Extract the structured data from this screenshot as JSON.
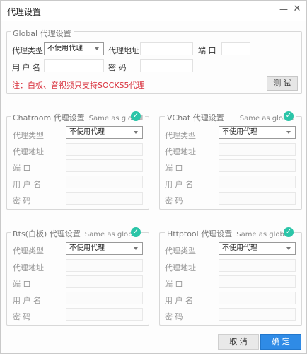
{
  "window": {
    "title": "代理设置",
    "minimize": "—",
    "close": "✕"
  },
  "global": {
    "legend": "Global 代理设置",
    "type_label": "代理类型",
    "type_value": "不使用代理",
    "address_label": "代理地址",
    "port_label": "端  口",
    "username_label": "用 户 名",
    "password_label": "密  码",
    "note": "注：白板、音视频只支持SOCKS5代理",
    "test_button": "测 试"
  },
  "same_as_global": "Same as global",
  "field_labels": {
    "type": "代理类型",
    "address": "代理地址",
    "port": "端  口",
    "username": "用 户 名",
    "password": "密  码"
  },
  "groups": [
    {
      "legend": "Chatroom 代理设置",
      "type_value": "不使用代理"
    },
    {
      "legend": "VChat 代理设置",
      "type_value": "不使用代理"
    },
    {
      "legend": "Rts(白板) 代理设置",
      "type_value": "不使用代理"
    },
    {
      "legend": "Httptool 代理设置",
      "type_value": "不使用代理"
    }
  ],
  "footer": {
    "cancel": "取 消",
    "ok": "确 定"
  },
  "colors": {
    "accent": "#2f8be6",
    "check": "#2bc5a8",
    "note": "#d9333f"
  },
  "icons": {
    "check": "check-circle-icon",
    "caret": "chevron-down-icon"
  }
}
